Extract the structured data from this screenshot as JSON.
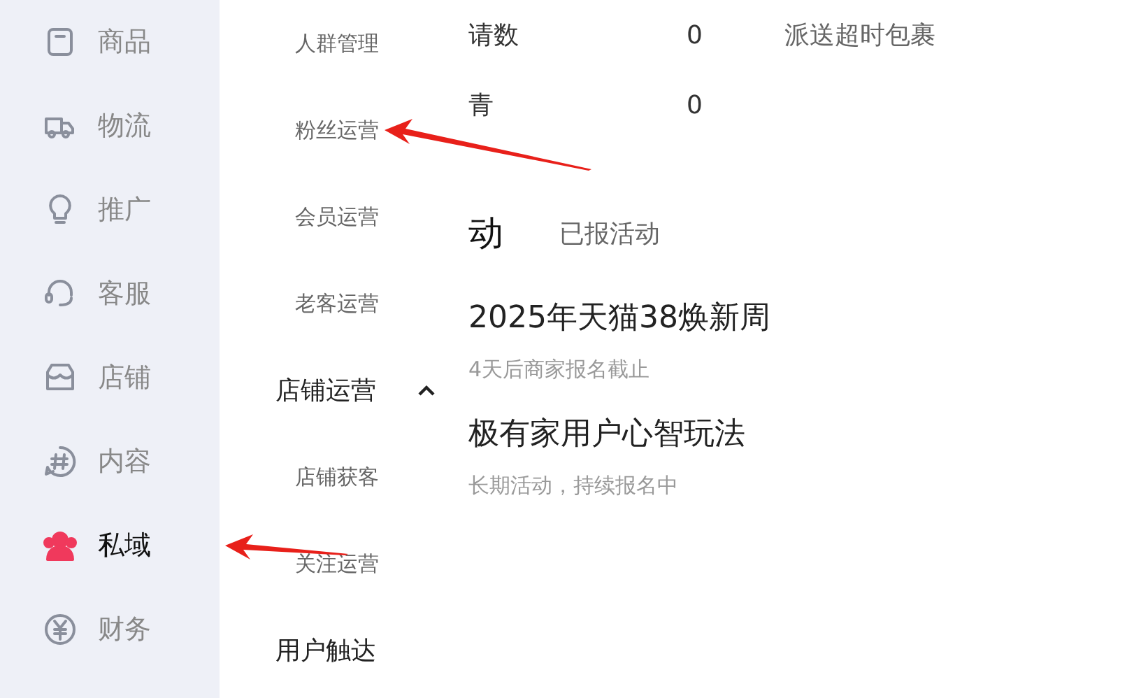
{
  "sidebar": {
    "items": [
      {
        "label": "商品",
        "selected": false,
        "pointed": false
      },
      {
        "label": "物流",
        "selected": false,
        "pointed": false
      },
      {
        "label": "推广",
        "selected": false,
        "pointed": false
      },
      {
        "label": "客服",
        "selected": false,
        "pointed": false
      },
      {
        "label": "店铺",
        "selected": false,
        "pointed": false
      },
      {
        "label": "内容",
        "selected": false,
        "pointed": false
      },
      {
        "label": "私域",
        "selected": true,
        "pointed": true
      },
      {
        "label": "财务",
        "selected": false,
        "pointed": false
      }
    ]
  },
  "submenu": {
    "items": [
      {
        "kind": "item",
        "label": "人群管理",
        "pointed": false
      },
      {
        "kind": "item",
        "label": "粉丝运营",
        "pointed": true
      },
      {
        "kind": "item",
        "label": "会员运营",
        "pointed": false
      },
      {
        "kind": "item",
        "label": "老客运营",
        "pointed": false
      },
      {
        "kind": "group",
        "label": "店铺运营",
        "expanded": true,
        "pointed": false
      },
      {
        "kind": "item",
        "label": "店铺获客",
        "pointed": false
      },
      {
        "kind": "item",
        "label": "关注运营",
        "pointed": false
      },
      {
        "kind": "group",
        "label": "用户触达",
        "expanded": false,
        "pointed": false
      }
    ]
  },
  "stats": [
    {
      "label": "请数",
      "value": "0",
      "extra": "派送超时包裹"
    },
    {
      "label": "青",
      "value": "0"
    }
  ],
  "activities": {
    "heading": "动",
    "tabs": [
      {
        "label": "已报活动",
        "selected": false
      }
    ],
    "items": [
      {
        "title": "2025年天猫38焕新周",
        "note": "4天后商家报名截止"
      },
      {
        "title": "极有家用户心智玩法",
        "note": "长期活动，持续报名中"
      }
    ]
  }
}
